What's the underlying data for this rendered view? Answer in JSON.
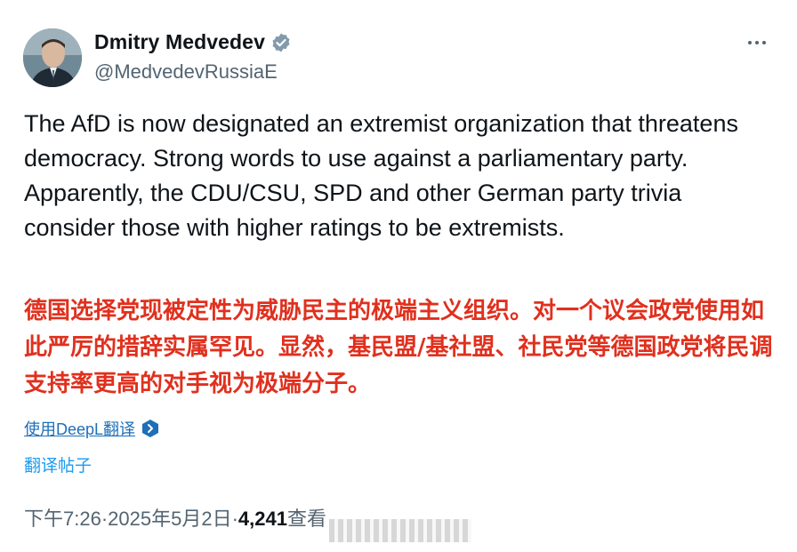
{
  "author": {
    "display_name": "Dmitry Medvedev",
    "handle": "@MedvedevRussiaE",
    "avatar_icon": "profile-photo",
    "verified_icon": "verified-badge-icon"
  },
  "post": {
    "text": "The AfD is now designated an extremist organization that threatens democracy. Strong words to use against a parliamentary party. Apparently, the CDU/CSU, SPD and other German party trivia consider those with higher ratings to be extremists.",
    "translation": "德国选择党现被定性为威胁民主的极端主义组织。对一个议会政党使用如此严厉的措辞实属罕见。显然，基民盟/基社盟、社民党等德国政党将民调支持率更高的对手视为极端分子。"
  },
  "actions": {
    "deepl_label": "使用DeepL翻译",
    "translate_label": "翻译帖子"
  },
  "meta": {
    "time": "下午7:26",
    "separator": " · ",
    "date": "2025年5月2日",
    "views": "4,241",
    "views_label": " 查看"
  },
  "colors": {
    "translation": "#e0301e",
    "link": "#1d9bf0",
    "secondary": "#536471",
    "verified": "#829aab"
  }
}
